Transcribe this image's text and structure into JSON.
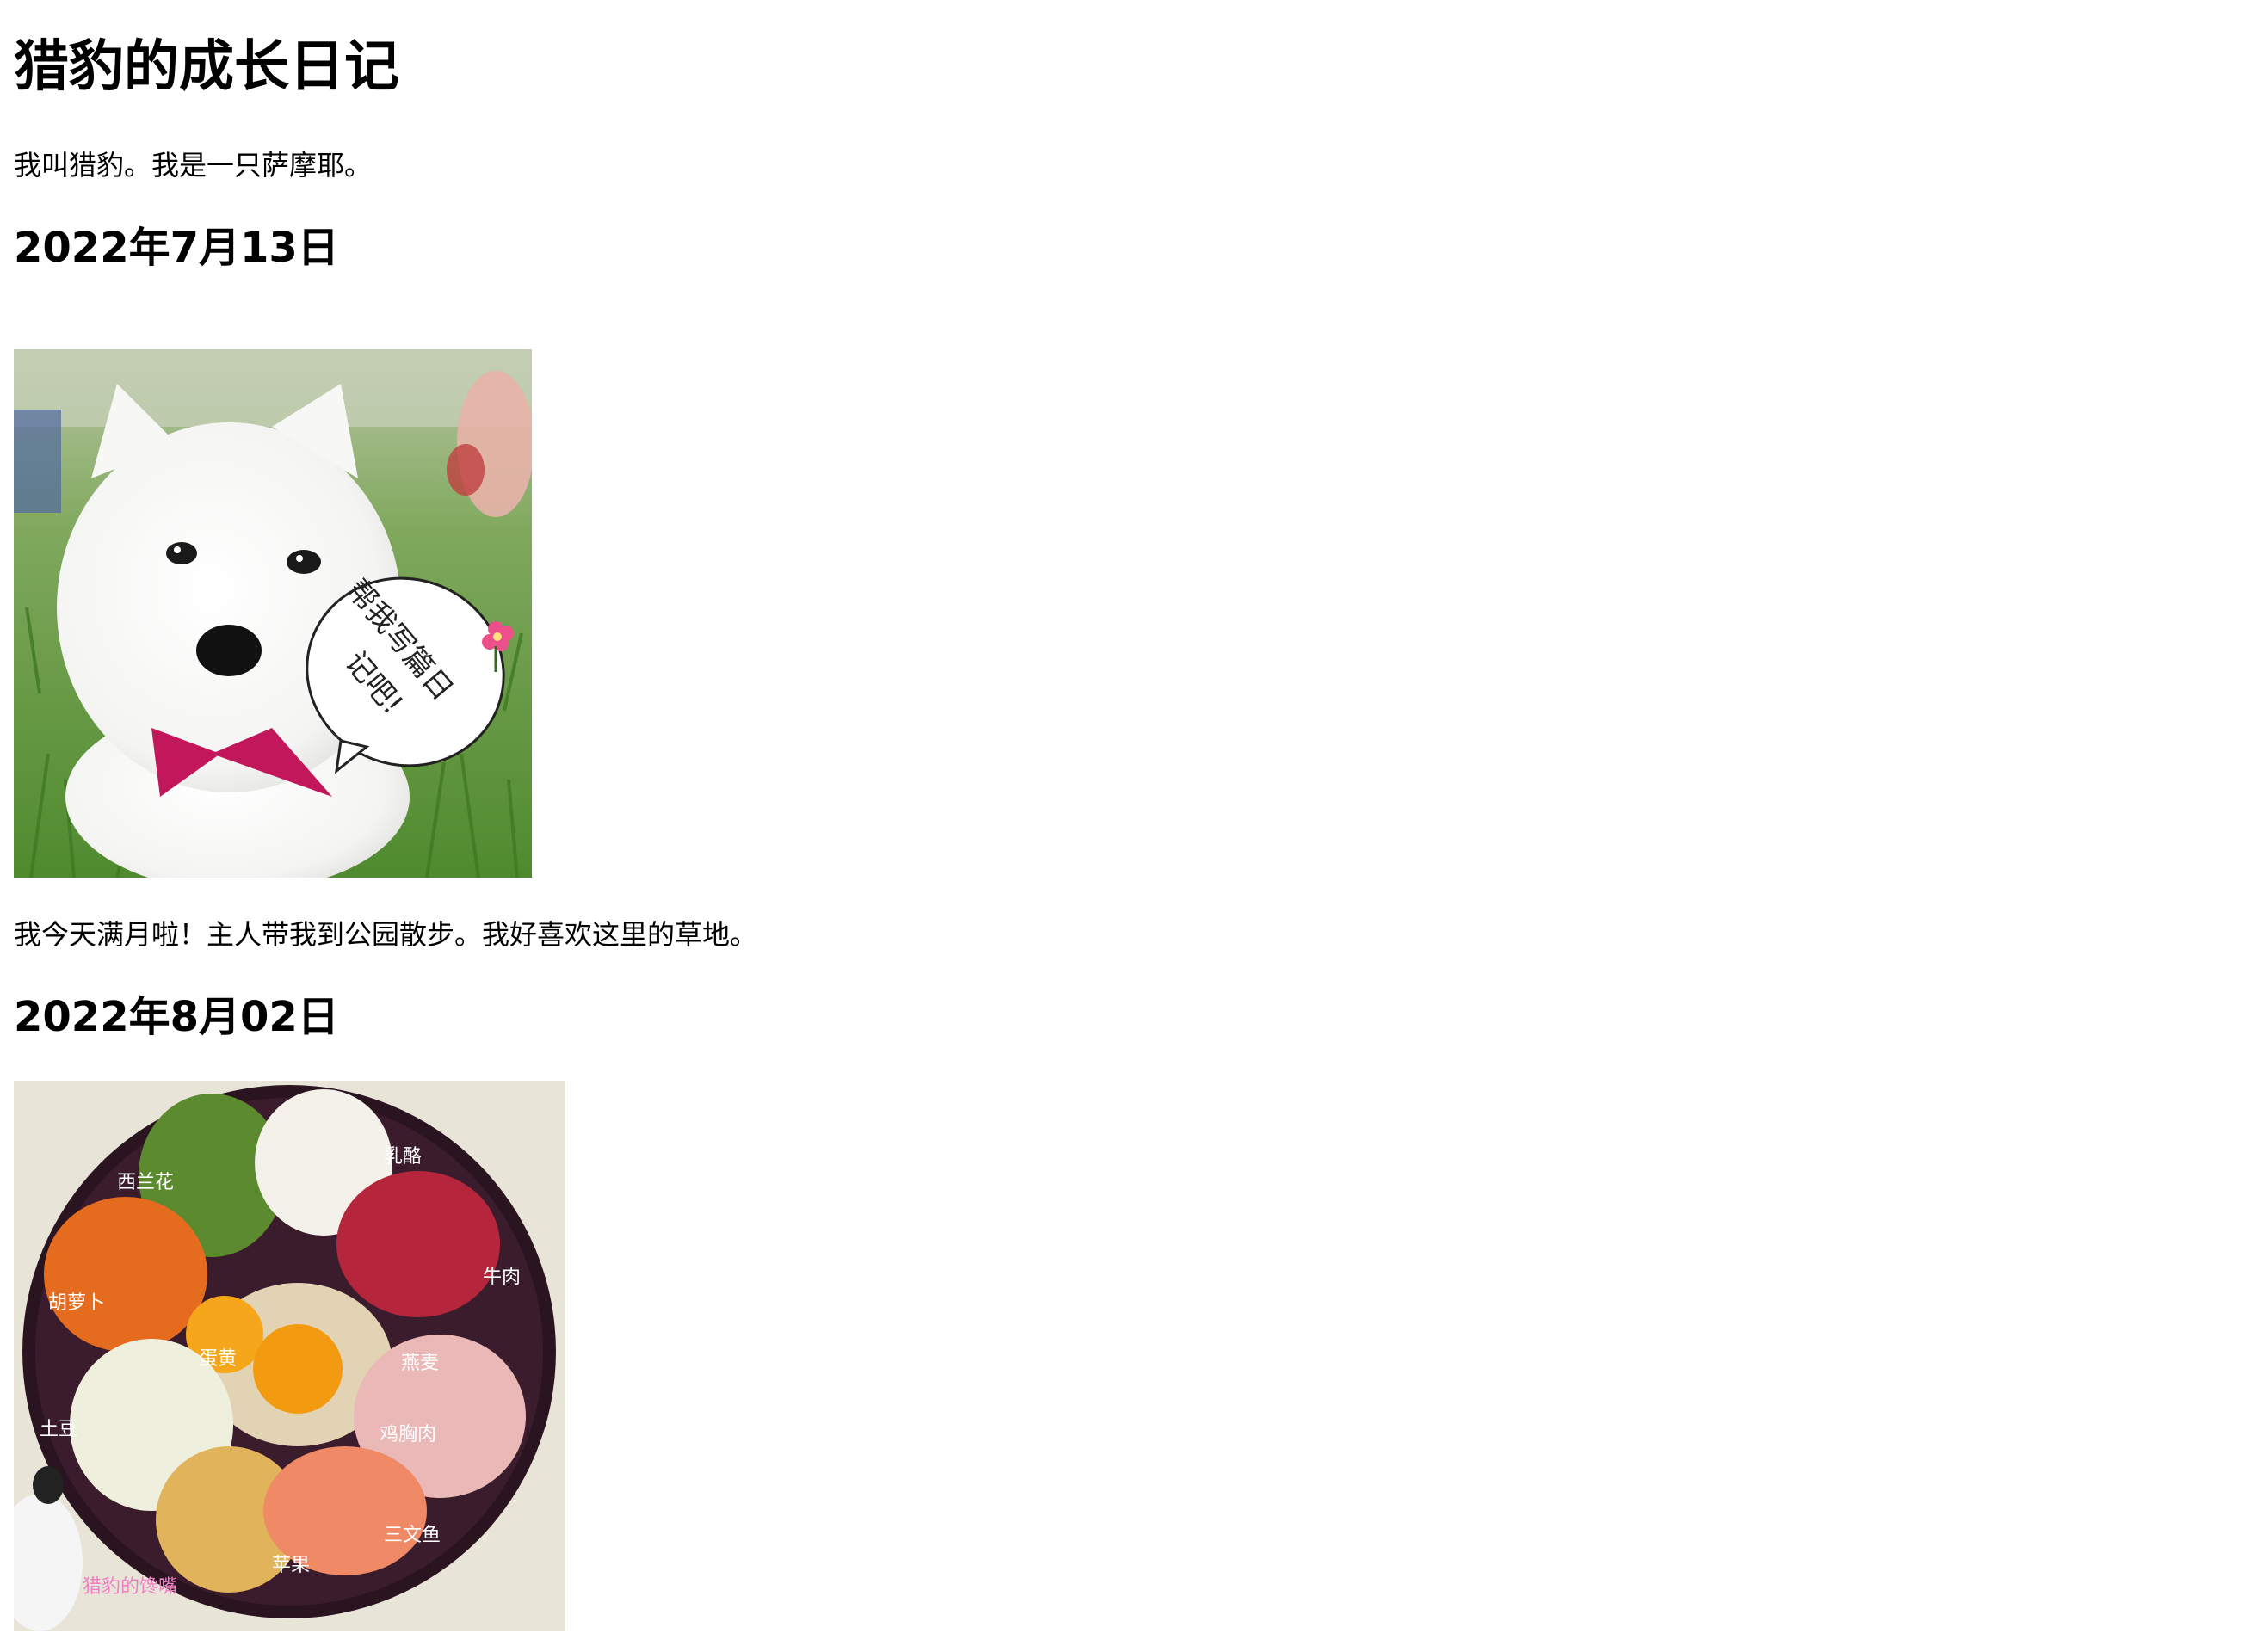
{
  "page": {
    "title": "猎豹的成长日记",
    "intro": "我叫猎豹。我是一只萨摩耶。"
  },
  "entries": [
    {
      "date": "2022年7月13日",
      "photo": {
        "bubble_text_line1": "帮我写篇日",
        "bubble_text_line2": "记吧!"
      },
      "text": "我今天满月啦！主人带我到公园散步。我好喜欢这里的草地。"
    },
    {
      "date": "2022年8月02日",
      "photo": {
        "labels": {
          "broccoli": "西兰花",
          "cottage_cheese": "乳酪",
          "beef": "牛肉",
          "carrot": "胡萝卜",
          "egg_yolk": "蛋黄",
          "oats": "燕麦",
          "potato": "土豆",
          "chicken": "鸡胸肉",
          "apple": "苹果",
          "salmon": "三文鱼"
        },
        "watermark": "猎豹的馋嘴"
      }
    }
  ],
  "colors": {
    "background": "#ffffff",
    "text": "#000000"
  }
}
